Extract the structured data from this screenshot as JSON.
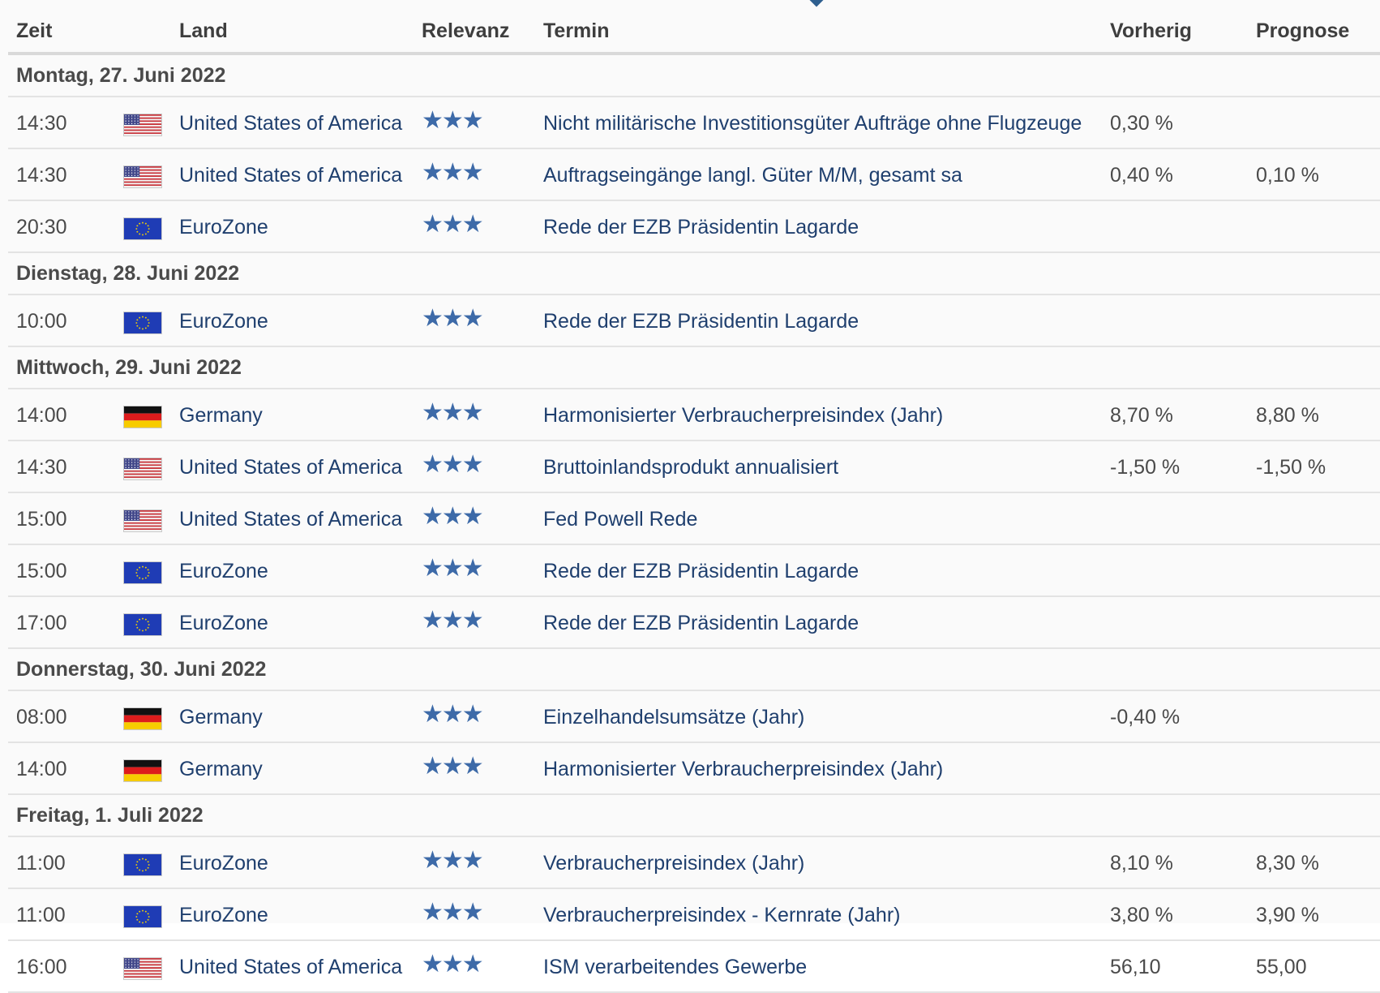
{
  "header": {
    "time": "Zeit",
    "country": "Land",
    "relevance": "Relevanz",
    "event": "Termin",
    "previous": "Vorherig",
    "forecast": "Prognose"
  },
  "colors": {
    "link": "#1f3f6e",
    "star": "#3d6aa8",
    "border": "#e3e3e3"
  },
  "relevance_max": 3,
  "days": [
    {
      "label": "Montag, 27. Juni 2022",
      "events": [
        {
          "time": "14:30",
          "flag": "us-flag-icon",
          "country": "United States of America",
          "stars": 3,
          "event": "Nicht militärische Investitionsgüter Aufträge ohne Flugzeuge",
          "previous": "0,30 %",
          "forecast": ""
        },
        {
          "time": "14:30",
          "flag": "us-flag-icon",
          "country": "United States of America",
          "stars": 3,
          "event": "Auftragseingänge langl. Güter M/M, gesamt sa",
          "previous": "0,40 %",
          "forecast": "0,10 %"
        },
        {
          "time": "20:30",
          "flag": "eu-flag-icon",
          "country": "EuroZone",
          "stars": 3,
          "event": "Rede der EZB Präsidentin Lagarde",
          "previous": "",
          "forecast": ""
        }
      ]
    },
    {
      "label": "Dienstag, 28. Juni 2022",
      "events": [
        {
          "time": "10:00",
          "flag": "eu-flag-icon",
          "country": "EuroZone",
          "stars": 3,
          "event": "Rede der EZB Präsidentin Lagarde",
          "previous": "",
          "forecast": ""
        }
      ]
    },
    {
      "label": "Mittwoch, 29. Juni 2022",
      "events": [
        {
          "time": "14:00",
          "flag": "de-flag-icon",
          "country": "Germany",
          "stars": 3,
          "event": "Harmonisierter Verbraucherpreisindex (Jahr)",
          "previous": "8,70 %",
          "forecast": "8,80 %"
        },
        {
          "time": "14:30",
          "flag": "us-flag-icon",
          "country": "United States of America",
          "stars": 3,
          "event": "Bruttoinlandsprodukt annualisiert",
          "previous": "-1,50 %",
          "forecast": "-1,50 %"
        },
        {
          "time": "15:00",
          "flag": "us-flag-icon",
          "country": "United States of America",
          "stars": 3,
          "event": "Fed Powell Rede",
          "previous": "",
          "forecast": ""
        },
        {
          "time": "15:00",
          "flag": "eu-flag-icon",
          "country": "EuroZone",
          "stars": 3,
          "event": "Rede der EZB Präsidentin Lagarde",
          "previous": "",
          "forecast": ""
        },
        {
          "time": "17:00",
          "flag": "eu-flag-icon",
          "country": "EuroZone",
          "stars": 3,
          "event": "Rede der EZB Präsidentin Lagarde",
          "previous": "",
          "forecast": ""
        }
      ]
    },
    {
      "label": "Donnerstag, 30. Juni 2022",
      "events": [
        {
          "time": "08:00",
          "flag": "de-flag-icon",
          "country": "Germany",
          "stars": 3,
          "event": "Einzelhandelsumsätze (Jahr)",
          "previous": "-0,40 %",
          "forecast": ""
        },
        {
          "time": "14:00",
          "flag": "de-flag-icon",
          "country": "Germany",
          "stars": 3,
          "event": "Harmonisierter Verbraucherpreisindex (Jahr)",
          "previous": "",
          "forecast": ""
        }
      ]
    },
    {
      "label": "Freitag, 1. Juli 2022",
      "events": [
        {
          "time": "11:00",
          "flag": "eu-flag-icon",
          "country": "EuroZone",
          "stars": 3,
          "event": "Verbraucherpreisindex (Jahr)",
          "previous": "8,10 %",
          "forecast": "8,30 %"
        },
        {
          "time": "11:00",
          "flag": "eu-flag-icon",
          "country": "EuroZone",
          "stars": 3,
          "event": "Verbraucherpreisindex - Kernrate (Jahr)",
          "previous": "3,80 %",
          "forecast": "3,90 %"
        },
        {
          "time": "16:00",
          "flag": "us-flag-icon",
          "country": "United States of America",
          "stars": 3,
          "event": "ISM verarbeitendes Gewerbe",
          "previous": "56,10",
          "forecast": "55,00"
        }
      ]
    }
  ]
}
